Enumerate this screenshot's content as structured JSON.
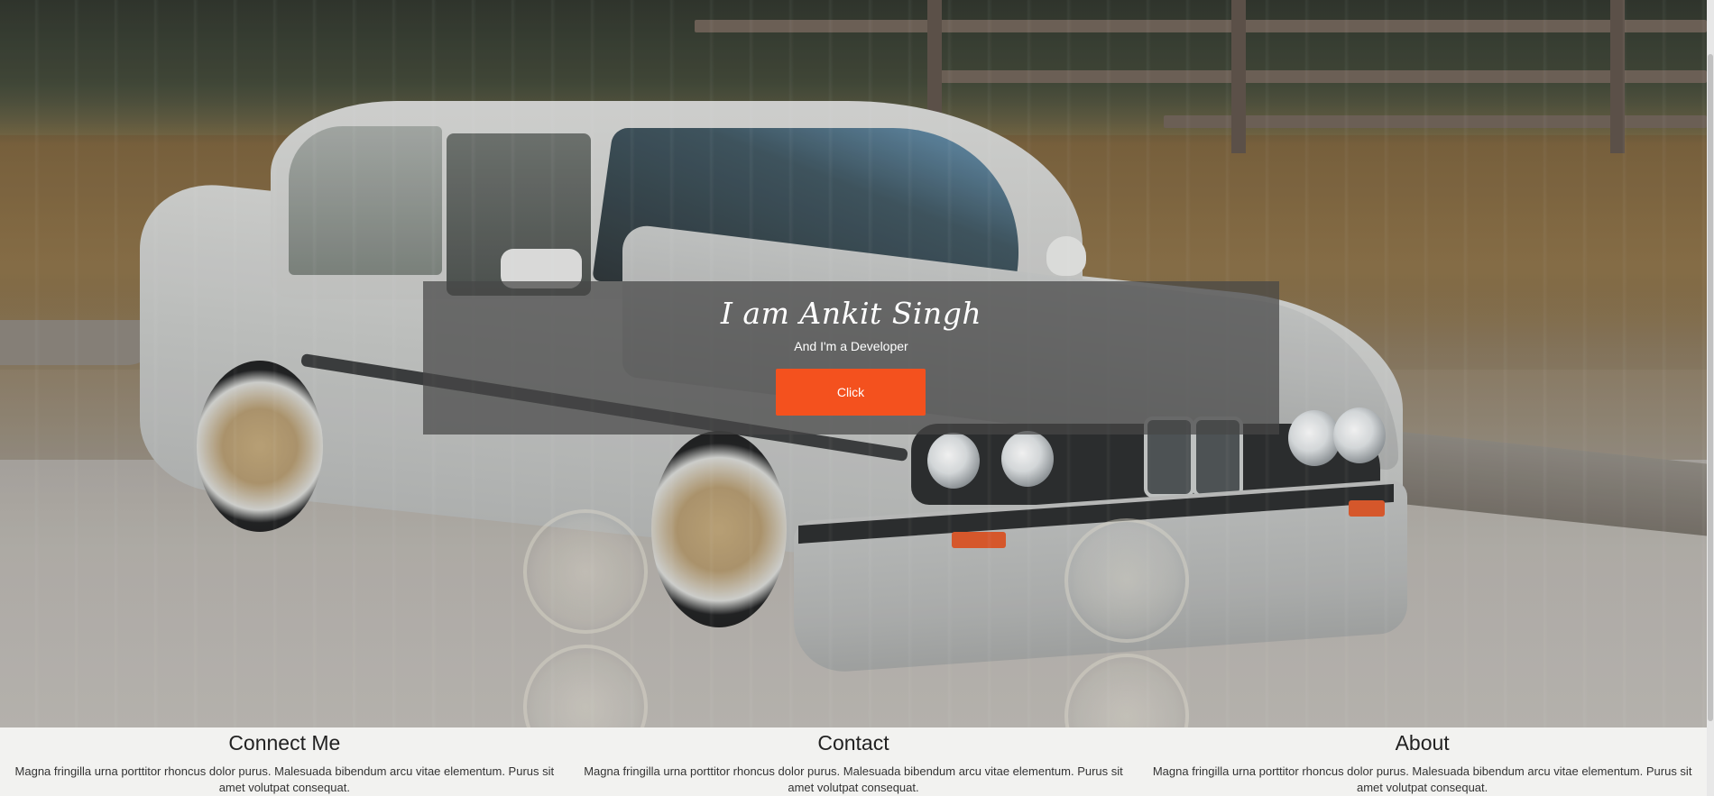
{
  "hero": {
    "title": "I am Ankit Singh",
    "subtitle": "And I'm a Developer",
    "button_label": "Click",
    "button_color": "#f4511e"
  },
  "footer": {
    "columns": [
      {
        "heading": "Connect Me",
        "text": "Magna fringilla urna porttitor rhoncus dolor purus. Malesuada bibendum arcu vitae elementum. Purus sit amet volutpat consequat."
      },
      {
        "heading": "Contact",
        "text": "Magna fringilla urna porttitor rhoncus dolor purus. Malesuada bibendum arcu vitae elementum. Purus sit amet volutpat consequat."
      },
      {
        "heading": "About",
        "text": "Magna fringilla urna porttitor rhoncus dolor purus. Malesuada bibendum arcu vitae elementum. Purus sit amet volutpat consequat."
      }
    ]
  }
}
